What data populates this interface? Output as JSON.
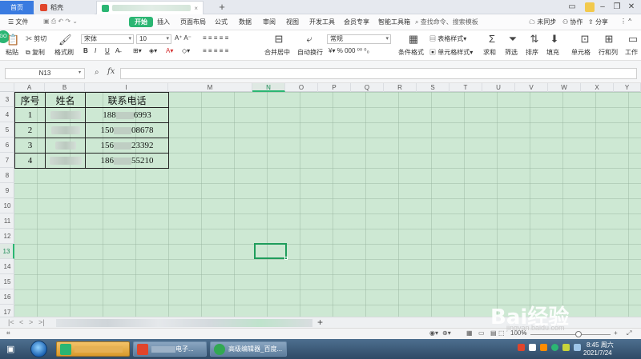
{
  "tabs": {
    "home": "首页",
    "shell": "稻壳",
    "add": "+"
  },
  "menu": {
    "file": "文件",
    "items": [
      "开始",
      "插入",
      "页面布局",
      "公式",
      "数据",
      "审阅",
      "视图",
      "开发工具",
      "会员专享",
      "智能工具箱"
    ],
    "search": "查找命令、搜索模板",
    "sync": "未同步",
    "collab": "协作",
    "share": "分享"
  },
  "ribbon": {
    "paste": "粘贴",
    "cut": "剪切",
    "copy": "复制",
    "format_painter": "格式刷",
    "font_name": "宋体",
    "font_size": "10",
    "number_format": "常规",
    "merge_center": "合并居中",
    "wrap": "自动换行",
    "table_style": "表格样式",
    "cond_format": "条件格式",
    "cell_style": "单元格样式",
    "sum": "求和",
    "filter": "筛选",
    "sort": "排序",
    "fill": "填充",
    "cell": "单元格",
    "row_col": "行和列",
    "worksheet": "工作",
    "bold": "B",
    "italic": "I",
    "underline": "U",
    "percent": "%",
    "thousands": "000",
    "currency": "¥"
  },
  "formula": {
    "name_box": "N13",
    "fx": "fx"
  },
  "columns": [
    "A",
    "B",
    "I",
    "M",
    "N",
    "O",
    "P",
    "Q",
    "R",
    "S",
    "T",
    "U",
    "V",
    "W",
    "X",
    "Y"
  ],
  "rows": [
    "3",
    "4",
    "5",
    "6",
    "7",
    "8",
    "9",
    "10",
    "11",
    "12",
    "13",
    "14",
    "15",
    "16",
    "17"
  ],
  "table": {
    "headers": [
      "序号",
      "姓名",
      "联系电话"
    ],
    "rows": [
      {
        "no": "1",
        "phone_prefix": "188",
        "phone_suffix": "6993"
      },
      {
        "no": "2",
        "phone_prefix": "150",
        "phone_suffix": "08678"
      },
      {
        "no": "3",
        "phone_prefix": "156",
        "phone_suffix": "23392"
      },
      {
        "no": "4",
        "phone_prefix": "186",
        "phone_suffix": "55210"
      }
    ]
  },
  "status": {
    "zoom": "100%"
  },
  "taskbar": {
    "task2_label": "电子...",
    "task3_label": "高级编辑器_百度...",
    "time": "8:45 周六",
    "date": "2021/7/24"
  },
  "watermark": {
    "brand": "Bai经验",
    "url": "jingyan.baidu.com"
  }
}
